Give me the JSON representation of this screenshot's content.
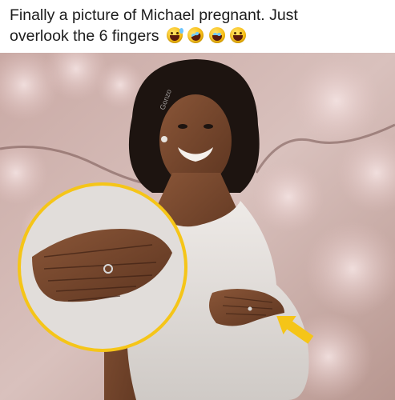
{
  "post": {
    "caption_line1": "Finally a picture of Michael pregnant. Just",
    "caption_line2": "overlook the 6 fingers",
    "emojis": [
      "grinning-sweat-emoji",
      "rolling-laughing-emoji",
      "tears-of-joy-emoji",
      "grinning-squinting-emoji"
    ]
  },
  "photo": {
    "watermark": "Gonzo",
    "highlight_color": "#f5c518",
    "arrow_color": "#f5c518"
  }
}
